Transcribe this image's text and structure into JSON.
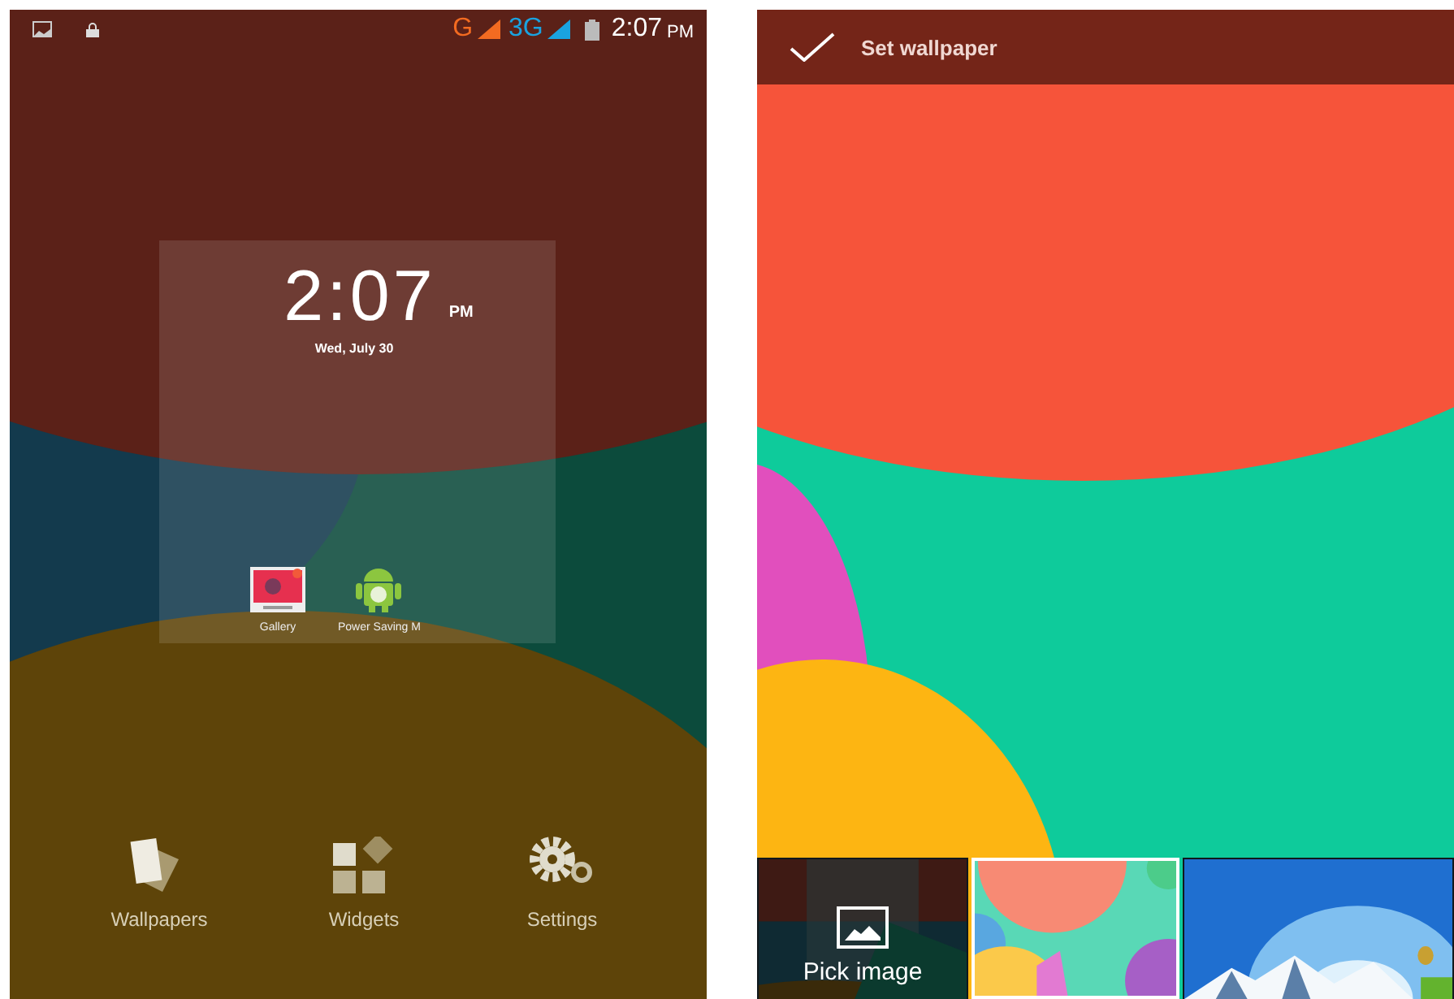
{
  "home_screen": {
    "status_bar": {
      "network": "G",
      "network_2": "3G",
      "time": "2:07",
      "time_suffix": "PM"
    },
    "clock_widget": {
      "time": "2:07",
      "suffix": "PM",
      "date": "Wed, July 30"
    },
    "apps": [
      {
        "label": "Gallery",
        "kind": "gallery"
      },
      {
        "label": "Power Saving M",
        "kind": "robot"
      }
    ],
    "overview_menu": [
      {
        "label": "Wallpapers",
        "kind": "wallpapers"
      },
      {
        "label": "Widgets",
        "kind": "widgets"
      },
      {
        "label": "Settings",
        "kind": "settings"
      }
    ]
  },
  "wallpaper_picker": {
    "action": "Set wallpaper",
    "thumbnails": [
      {
        "kind": "pick",
        "label": "Pick image",
        "selected": false
      },
      {
        "kind": "circles",
        "selected": true
      },
      {
        "kind": "mountain",
        "selected": false
      }
    ]
  }
}
